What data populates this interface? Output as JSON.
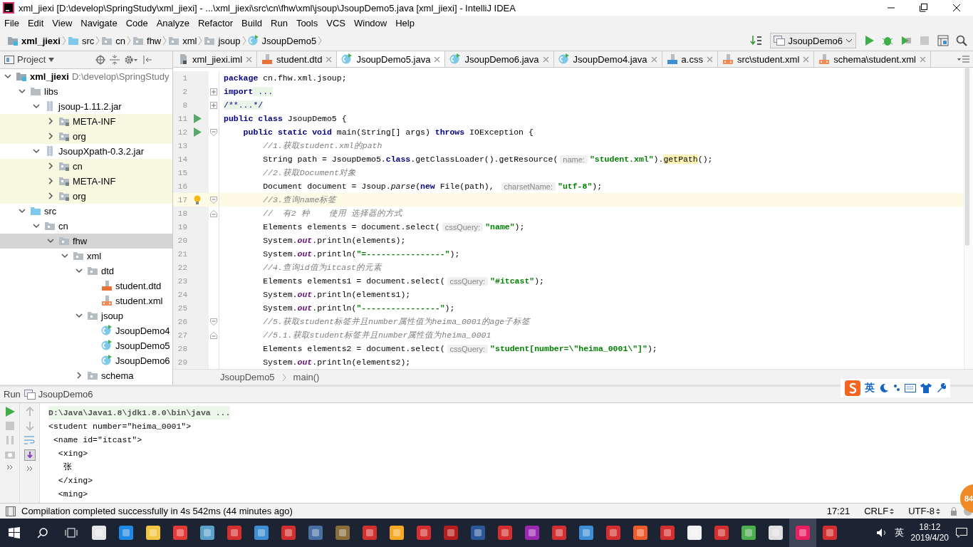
{
  "window": {
    "title": "xml_jiexi [D:\\develop\\SpringStudy\\xml_jiexi] - ...\\xml_jiexi\\src\\cn\\fhw\\xml\\jsoup\\JsoupDemo5.java [xml_jiexi] - IntelliJ IDEA"
  },
  "menu": [
    "File",
    "Edit",
    "View",
    "Navigate",
    "Code",
    "Analyze",
    "Refactor",
    "Build",
    "Run",
    "Tools",
    "VCS",
    "Window",
    "Help"
  ],
  "breadcrumbs": [
    {
      "label": "xml_jiexi",
      "kind": "module"
    },
    {
      "label": "src",
      "kind": "source-folder"
    },
    {
      "label": "cn",
      "kind": "package"
    },
    {
      "label": "fhw",
      "kind": "package"
    },
    {
      "label": "xml",
      "kind": "package"
    },
    {
      "label": "jsoup",
      "kind": "package"
    },
    {
      "label": "JsoupDemo5",
      "kind": "class"
    }
  ],
  "run_configuration": "JsoupDemo6",
  "project_panel": {
    "title": "Project"
  },
  "tree": [
    {
      "label": "xml_jiexi",
      "path": "D:\\develop\\SpringStudy",
      "kind": "module",
      "expanded": true,
      "selected": false,
      "children": [
        {
          "label": "libs",
          "kind": "folder",
          "expanded": true,
          "selected": false,
          "children": [
            {
              "label": "jsoup-1.11.2.jar",
              "kind": "jar",
              "expanded": true,
              "selected": false,
              "children": [
                {
                  "label": "META-INF",
                  "kind": "lib-package",
                  "expanded": false,
                  "selected": false,
                  "library": true
                },
                {
                  "label": "org",
                  "kind": "lib-package",
                  "expanded": false,
                  "selected": false,
                  "library": true
                }
              ]
            },
            {
              "label": "JsoupXpath-0.3.2.jar",
              "kind": "jar",
              "expanded": true,
              "selected": false,
              "children": [
                {
                  "label": "cn",
                  "kind": "lib-package",
                  "expanded": false,
                  "selected": false,
                  "library": true
                },
                {
                  "label": "META-INF",
                  "kind": "lib-package",
                  "expanded": false,
                  "selected": false,
                  "library": true
                },
                {
                  "label": "org",
                  "kind": "lib-package",
                  "expanded": false,
                  "selected": false,
                  "library": true
                }
              ]
            }
          ]
        },
        {
          "label": "src",
          "kind": "source-folder",
          "expanded": true,
          "selected": false,
          "children": [
            {
              "label": "cn",
              "kind": "package",
              "expanded": true,
              "selected": false,
              "children": [
                {
                  "label": "fhw",
                  "kind": "package",
                  "expanded": true,
                  "selected": true,
                  "children": [
                    {
                      "label": "xml",
                      "kind": "package",
                      "expanded": true,
                      "selected": false,
                      "children": [
                        {
                          "label": "dtd",
                          "kind": "package",
                          "expanded": true,
                          "selected": false,
                          "children": [
                            {
                              "label": "student.dtd",
                              "kind": "dtd",
                              "selected": false
                            },
                            {
                              "label": "student.xml",
                              "kind": "xml",
                              "selected": false
                            }
                          ]
                        },
                        {
                          "label": "jsoup",
                          "kind": "package",
                          "expanded": true,
                          "selected": false,
                          "children": [
                            {
                              "label": "JsoupDemo4",
                              "kind": "class",
                              "selected": false
                            },
                            {
                              "label": "JsoupDemo5",
                              "kind": "class",
                              "selected": false
                            },
                            {
                              "label": "JsoupDemo6",
                              "kind": "class",
                              "selected": false
                            }
                          ]
                        },
                        {
                          "label": "schema",
                          "kind": "package",
                          "expanded": false,
                          "selected": false
                        }
                      ]
                    }
                  ]
                }
              ]
            }
          ]
        }
      ]
    }
  ],
  "tabs": [
    {
      "label": "xml_jiexi.iml",
      "kind": "iml",
      "selected": false
    },
    {
      "label": "student.dtd",
      "kind": "dtd",
      "selected": false
    },
    {
      "label": "JsoupDemo5.java",
      "kind": "class",
      "selected": true
    },
    {
      "label": "JsoupDemo6.java",
      "kind": "class",
      "selected": false
    },
    {
      "label": "JsoupDemo4.java",
      "kind": "class",
      "selected": false
    },
    {
      "label": "a.css",
      "kind": "css",
      "selected": false
    },
    {
      "label": "src\\student.xml",
      "kind": "xml",
      "selected": false
    },
    {
      "label": "schema\\student.xml",
      "kind": "xml",
      "selected": false
    }
  ],
  "code": [
    {
      "number": "1",
      "tokens": [
        {
          "kind": "keyword",
          "text": "package"
        },
        {
          "kind": "plain",
          "text": " cn.fhw.xml.jsoup;"
        }
      ]
    },
    {
      "number": "2",
      "collapsed": true,
      "tokens": [
        {
          "kind": "keyword",
          "text": "import"
        },
        {
          "kind": "folded",
          "text": " ..."
        }
      ]
    },
    {
      "number": "8",
      "collapsed": true,
      "tokens": [
        {
          "kind": "folded",
          "text": "/**...*/"
        }
      ]
    },
    {
      "number": "11",
      "run": true,
      "tokens": [
        {
          "kind": "keyword",
          "text": "public class"
        },
        {
          "kind": "plain",
          "text": " JsoupDemo5 {"
        }
      ]
    },
    {
      "number": "12",
      "run": true,
      "fold_start": true,
      "tokens": [
        {
          "kind": "keyword",
          "text": "    public static void"
        },
        {
          "kind": "plain",
          "text": " main(String[] args) "
        },
        {
          "kind": "keyword",
          "text": "throws"
        },
        {
          "kind": "plain",
          "text": " IOException {"
        }
      ]
    },
    {
      "number": "13",
      "tokens": [
        {
          "kind": "comment",
          "text": "        //1.获取student.xml的path"
        }
      ]
    },
    {
      "number": "14",
      "tokens": [
        {
          "kind": "plain",
          "text": "        String path = JsoupDemo5."
        },
        {
          "kind": "keyword",
          "text": "class"
        },
        {
          "kind": "plain",
          "text": ".getClassLoader().getResource("
        },
        {
          "kind": "hint",
          "text": "name:"
        },
        {
          "kind": "string",
          "text": "\"student.xml\""
        },
        {
          "kind": "plain",
          "text": ")."
        },
        {
          "kind": "marked",
          "text": "getPath"
        },
        {
          "kind": "plain",
          "text": "();"
        }
      ]
    },
    {
      "number": "15",
      "tokens": [
        {
          "kind": "comment",
          "text": "        //2.获取Document对象"
        }
      ]
    },
    {
      "number": "16",
      "tokens": [
        {
          "kind": "plain",
          "text": "        Document document = Jsoup."
        },
        {
          "kind": "static",
          "text": "parse"
        },
        {
          "kind": "plain",
          "text": "("
        },
        {
          "kind": "keyword",
          "text": "new"
        },
        {
          "kind": "plain",
          "text": " File(path), "
        },
        {
          "kind": "hint",
          "text": "charsetName:"
        },
        {
          "kind": "string",
          "text": "\"utf-8\""
        },
        {
          "kind": "plain",
          "text": ");"
        }
      ]
    },
    {
      "number": "17",
      "current": true,
      "bulb": true,
      "fold_start": true,
      "tokens": [
        {
          "kind": "comment",
          "text": "        //3.查询name标签"
        }
      ]
    },
    {
      "number": "18",
      "fold_end": true,
      "tokens": [
        {
          "kind": "comment",
          "text": "        //  有2 种    使用 选择器的方式"
        }
      ]
    },
    {
      "number": "19",
      "tokens": [
        {
          "kind": "plain",
          "text": "        Elements elements = document.select("
        },
        {
          "kind": "hint",
          "text": "cssQuery:"
        },
        {
          "kind": "string",
          "text": "\"name\""
        },
        {
          "kind": "plain",
          "text": ");"
        }
      ]
    },
    {
      "number": "20",
      "tokens": [
        {
          "kind": "plain",
          "text": "        System."
        },
        {
          "kind": "field",
          "text": "out"
        },
        {
          "kind": "plain",
          "text": ".println(elements);"
        }
      ]
    },
    {
      "number": "21",
      "tokens": [
        {
          "kind": "plain",
          "text": "        System."
        },
        {
          "kind": "field",
          "text": "out"
        },
        {
          "kind": "plain",
          "text": ".println("
        },
        {
          "kind": "string",
          "text": "\"=----------------\""
        },
        {
          "kind": "plain",
          "text": ");"
        }
      ]
    },
    {
      "number": "22",
      "tokens": [
        {
          "kind": "comment",
          "text": "        //4.查询id值为itcast的元素"
        }
      ]
    },
    {
      "number": "23",
      "tokens": [
        {
          "kind": "plain",
          "text": "        Elements elements1 = document.select("
        },
        {
          "kind": "hint",
          "text": "cssQuery:"
        },
        {
          "kind": "string",
          "text": "\"#itcast\""
        },
        {
          "kind": "plain",
          "text": ");"
        }
      ]
    },
    {
      "number": "24",
      "tokens": [
        {
          "kind": "plain",
          "text": "        System."
        },
        {
          "kind": "field",
          "text": "out"
        },
        {
          "kind": "plain",
          "text": ".println(elements1);"
        }
      ]
    },
    {
      "number": "25",
      "tokens": [
        {
          "kind": "plain",
          "text": "        System."
        },
        {
          "kind": "field",
          "text": "out"
        },
        {
          "kind": "plain",
          "text": ".println("
        },
        {
          "kind": "string",
          "text": "\"----------------\""
        },
        {
          "kind": "plain",
          "text": ");"
        }
      ]
    },
    {
      "number": "26",
      "fold_start": true,
      "tokens": [
        {
          "kind": "comment",
          "text": "        //5.获取student标签并且number属性值为heima_0001的age子标签"
        }
      ]
    },
    {
      "number": "27",
      "fold_end": true,
      "tokens": [
        {
          "kind": "comment",
          "text": "        //5.1.获取student标签并且number属性值为heima_0001"
        }
      ]
    },
    {
      "number": "28",
      "tokens": [
        {
          "kind": "plain",
          "text": "        Elements elements2 = document.select("
        },
        {
          "kind": "hint",
          "text": "cssQuery:"
        },
        {
          "kind": "string",
          "text": "\"student[number=\\\"heima_0001\\\"]\""
        },
        {
          "kind": "plain",
          "text": ");"
        }
      ]
    },
    {
      "number": "29",
      "tokens": [
        {
          "kind": "plain",
          "text": "        System."
        },
        {
          "kind": "field",
          "text": "out"
        },
        {
          "kind": "plain",
          "text": ".println(elements2);"
        }
      ]
    }
  ],
  "editor_breadcrumbs": [
    "JsoupDemo5",
    "main()"
  ],
  "ime": {
    "label": "英"
  },
  "run_panel": {
    "title": "Run",
    "configuration": "JsoupDemo6",
    "lines": [
      {
        "kind": "command",
        "text": "D:\\Java\\Java1.8\\jdk1.8.0\\bin\\java ..."
      },
      {
        "kind": "output",
        "text": "<student number=\"heima_0001\">"
      },
      {
        "kind": "output",
        "text": " <name id=\"itcast\">"
      },
      {
        "kind": "output",
        "text": "  <xing>"
      },
      {
        "kind": "output",
        "text": "   张"
      },
      {
        "kind": "output",
        "text": "  </xing>"
      },
      {
        "kind": "output",
        "text": "  <ming>"
      }
    ]
  },
  "status_bar": {
    "message": "Compilation completed successfully in 4s 542ms (44 minutes ago)",
    "position": "17:21",
    "line_separator": "CRLF",
    "encoding": "UTF-8"
  },
  "badge": "84",
  "taskbar": {
    "ime": "英",
    "time": "18:12",
    "date": "2019/4/20"
  }
}
